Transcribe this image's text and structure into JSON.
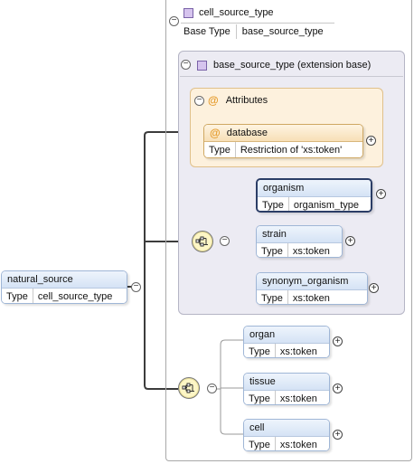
{
  "root": {
    "name": "natural_source",
    "type_key": "Type",
    "type_value": "cell_source_type"
  },
  "complex_type": {
    "name": "cell_source_type",
    "base_key": "Base Type",
    "base_value": "base_source_type"
  },
  "extension": {
    "title": "base_source_type (extension base)"
  },
  "attributes": {
    "title": "Attributes",
    "items": [
      {
        "name": "database",
        "type_key": "Type",
        "type_value": "Restriction of 'xs:token'"
      }
    ]
  },
  "base_sequence": [
    {
      "name": "organism",
      "type_key": "Type",
      "type_value": "organism_type"
    },
    {
      "name": "strain",
      "type_key": "Type",
      "type_value": "xs:token"
    },
    {
      "name": "synonym_organism",
      "type_key": "Type",
      "type_value": "xs:token"
    }
  ],
  "ext_sequence": [
    {
      "name": "organ",
      "type_key": "Type",
      "type_value": "xs:token"
    },
    {
      "name": "tissue",
      "type_key": "Type",
      "type_value": "xs:token"
    },
    {
      "name": "cell",
      "type_key": "Type",
      "type_value": "xs:token"
    }
  ],
  "colors": {
    "element_header": "#d5e3f5",
    "attribute_header": "#f7dfb6",
    "extension_bg": "#ecebf3",
    "attributes_bg": "#fdf1dd",
    "sequence_bg": "#fdf6c6",
    "selected_border": "#2b3d66"
  }
}
